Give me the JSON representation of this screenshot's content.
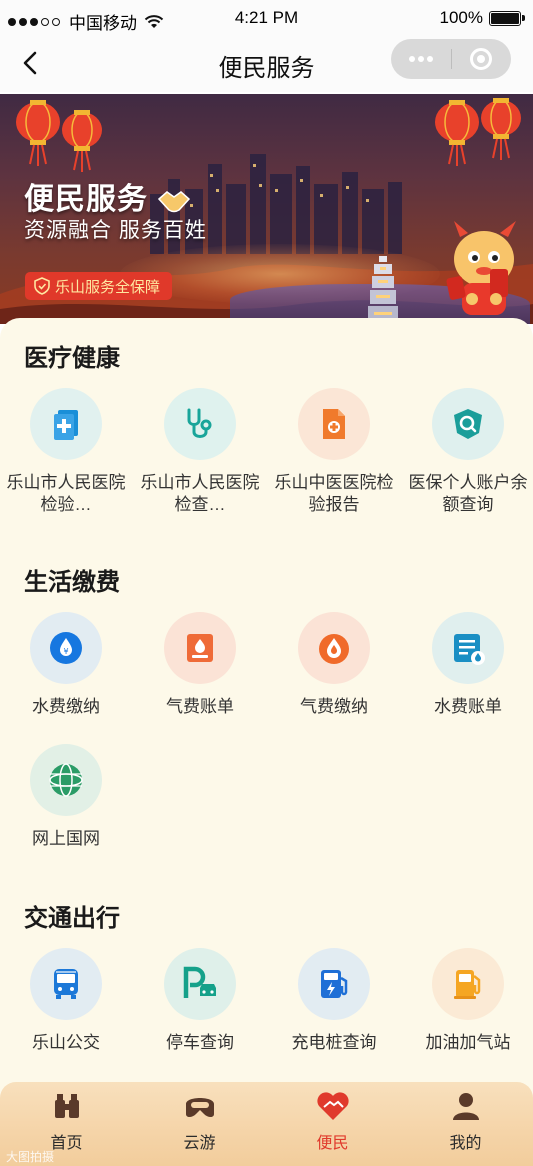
{
  "status_bar": {
    "carrier": "中国移动",
    "time": "4:21 PM",
    "battery": "100%"
  },
  "nav": {
    "title": "便民服务"
  },
  "banner": {
    "title": "便民服务",
    "subtitle": "资源融合 服务百姓",
    "badge": "乐山服务全保障"
  },
  "sections": [
    {
      "title": "医疗健康",
      "items": [
        {
          "label": "乐山市人民医院检验…",
          "icon": "medical-report-icon",
          "bg": "#e1f1ef",
          "color": "#1a8fd8"
        },
        {
          "label": "乐山市人民医院检查…",
          "icon": "stethoscope-icon",
          "bg": "#dff2ee",
          "color": "#19a59a"
        },
        {
          "label": "乐山中医医院检验报告",
          "icon": "medical-document-icon",
          "bg": "#fbe6d6",
          "color": "#f07a2c"
        },
        {
          "label": "医保个人账户余额查询",
          "icon": "insurance-search-icon",
          "bg": "#dff0ee",
          "color": "#1b9e9a"
        }
      ]
    },
    {
      "title": "生活缴费",
      "items": [
        {
          "label": "水费缴纳",
          "icon": "water-drop-icon",
          "bg": "#e2ecf2",
          "color": "#1677e0"
        },
        {
          "label": "气费账单",
          "icon": "gas-bill-icon",
          "bg": "#fbe3d6",
          "color": "#ef6b38"
        },
        {
          "label": "气费缴纳",
          "icon": "flame-icon",
          "bg": "#fbe3d6",
          "color": "#f06a2a"
        },
        {
          "label": "水费账单",
          "icon": "water-bill-icon",
          "bg": "#e0efee",
          "color": "#1a8fc4"
        },
        {
          "label": "网上国网",
          "icon": "state-grid-icon",
          "bg": "#e2f0e6",
          "color": "#2b9c67"
        }
      ]
    },
    {
      "title": "交通出行",
      "items": [
        {
          "label": "乐山公交",
          "icon": "bus-icon",
          "bg": "#e2ecf2",
          "color": "#1c78d8"
        },
        {
          "label": "停车查询",
          "icon": "parking-icon",
          "bg": "#dff0ea",
          "color": "#15a18a"
        },
        {
          "label": "充电桩查询",
          "icon": "charging-station-icon",
          "bg": "#e2ecf2",
          "color": "#1f6fd6"
        },
        {
          "label": "加油加气站",
          "icon": "fuel-station-icon",
          "bg": "#fbead5",
          "color": "#f5a623"
        }
      ]
    }
  ],
  "tabbar": {
    "items": [
      {
        "label": "首页",
        "icon": "binoculars-icon",
        "active": false
      },
      {
        "label": "云游",
        "icon": "vr-glasses-icon",
        "active": false
      },
      {
        "label": "便民",
        "icon": "heart-handshake-icon",
        "active": true
      },
      {
        "label": "我的",
        "icon": "user-icon",
        "active": false
      }
    ]
  },
  "watermark": "大图拍摄"
}
